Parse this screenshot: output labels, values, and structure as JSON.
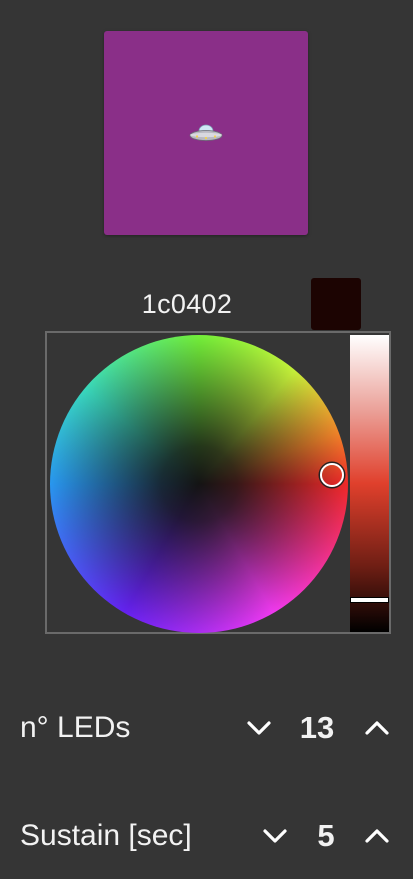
{
  "preview": {
    "color": "#8a2f88",
    "icon": "ufo-icon"
  },
  "color_picker": {
    "hex": "1c0402",
    "swatch_color": "#1c0402",
    "brightness_fraction": 0.06
  },
  "controls": {
    "leds": {
      "label": "n° LEDs",
      "value": "13",
      "decrement_icon": "chevron-down-icon",
      "increment_icon": "chevron-up-icon"
    },
    "sustain": {
      "label": "Sustain [sec]",
      "value": "5",
      "decrement_icon": "chevron-down-icon",
      "increment_icon": "chevron-up-icon"
    }
  }
}
